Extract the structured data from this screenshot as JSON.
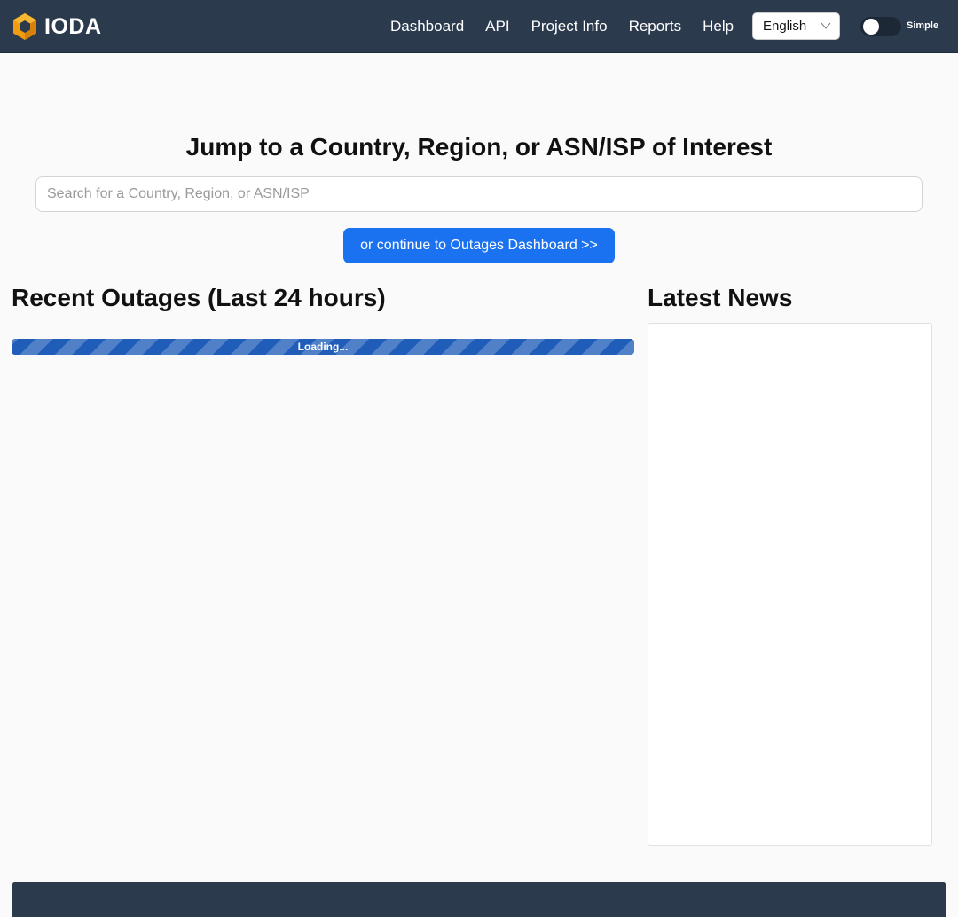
{
  "brand": {
    "name": "IODA",
    "logo_icon": "ioda-cube-logo",
    "accent": "#f39c12"
  },
  "nav": {
    "links": [
      "Dashboard",
      "API",
      "Project Info",
      "Reports",
      "Help"
    ],
    "language": "English",
    "mode_label": "Simple"
  },
  "hero": {
    "title": "Jump to a Country, Region, or ASN/ISP of Interest",
    "search_placeholder": "Search for a Country, Region, or ASN/ISP",
    "dashboard_button": "or continue to Outages Dashboard >>"
  },
  "outages": {
    "title": "Recent Outages (Last 24 hours)",
    "loading_text": "Loading..."
  },
  "news": {
    "title": "Latest News"
  },
  "colors": {
    "navbar": "#2c3a4e",
    "primary_button": "#1a72f0",
    "loading_bar": "#1f5db8"
  }
}
